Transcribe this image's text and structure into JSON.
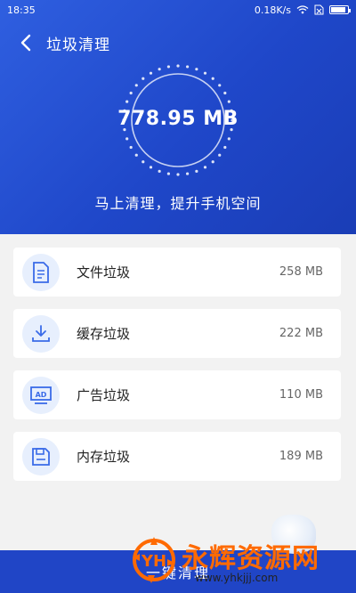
{
  "status": {
    "time": "18:35",
    "speed": "0.18K/s"
  },
  "header": {
    "title": "垃圾清理"
  },
  "summary": {
    "size": "778.95 MB",
    "subtitle": "马上清理，提升手机空间"
  },
  "items": [
    {
      "label": "文件垃圾",
      "size": "258 MB",
      "icon": "file-icon"
    },
    {
      "label": "缓存垃圾",
      "size": "222 MB",
      "icon": "download-icon"
    },
    {
      "label": "广告垃圾",
      "size": "110 MB",
      "icon": "ad-icon"
    },
    {
      "label": "内存垃圾",
      "size": "189 MB",
      "icon": "memory-icon"
    }
  ],
  "bottom": {
    "label": "一键清理"
  },
  "watermark": {
    "brand": "永辉资源网",
    "url": "www.yhkjjj.com"
  },
  "colors": {
    "primary": "#1f47c9",
    "icon_bg": "#e7effd",
    "icon_stroke": "#3a6be8",
    "watermark": "#ff6a00"
  }
}
